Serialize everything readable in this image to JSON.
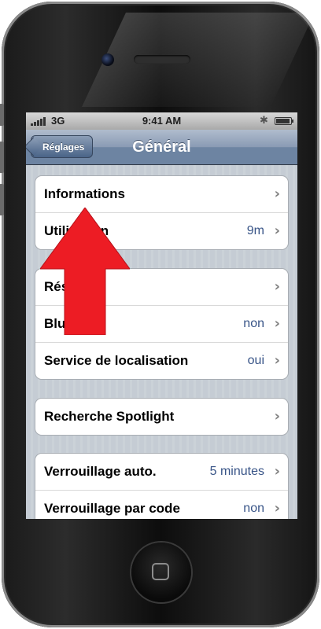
{
  "status_bar": {
    "network": "3G",
    "time": "9:41 AM"
  },
  "nav": {
    "back": "Réglages",
    "title": "Général"
  },
  "groups": [
    {
      "rows": [
        {
          "label": "Informations",
          "value": ""
        },
        {
          "label": "Utilisation",
          "value": "9m"
        }
      ]
    },
    {
      "rows": [
        {
          "label": "Réseau",
          "value": ""
        },
        {
          "label": "Bluetooth",
          "value": "non"
        },
        {
          "label": "Service de localisation",
          "value": "oui"
        }
      ]
    },
    {
      "rows": [
        {
          "label": "Recherche Spotlight",
          "value": ""
        }
      ]
    },
    {
      "rows": [
        {
          "label": "Verrouillage auto.",
          "value": "5 minutes"
        },
        {
          "label": "Verrouillage par code",
          "value": "non"
        }
      ]
    }
  ],
  "colors": {
    "arrow": "#ed1c24",
    "value_text": "#385487",
    "nav": "#6d84a2"
  },
  "icons": [
    "signal-icon",
    "bluetooth-icon",
    "battery-icon",
    "chevron-right-icon",
    "red-arrow-annotation"
  ]
}
